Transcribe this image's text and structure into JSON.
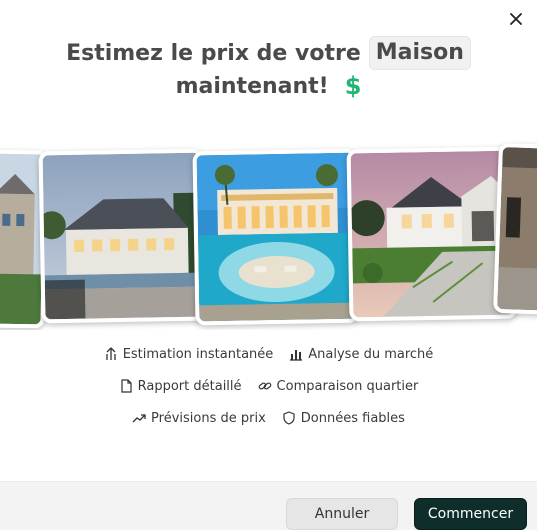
{
  "dialog": {
    "title_part1": "Estimez le prix de votre",
    "title_highlight": "Maison",
    "title_part2": "maintenant!",
    "dollar_symbol": "$",
    "accent_green": "#22b573"
  },
  "features": [
    {
      "icon": "antenna-icon",
      "label": "Estimation instantanée"
    },
    {
      "icon": "bar-chart-icon",
      "label": "Analyse du marché"
    },
    {
      "icon": "document-icon",
      "label": "Rapport détaillé"
    },
    {
      "icon": "link-icon",
      "label": "Comparaison quartier"
    },
    {
      "icon": "trend-up-icon",
      "label": "Prévisions de prix"
    },
    {
      "icon": "shield-icon",
      "label": "Données fiables"
    }
  ],
  "footer": {
    "cancel_label": "Annuler",
    "start_label": "Commencer",
    "start_color": "#0f2d2a"
  }
}
